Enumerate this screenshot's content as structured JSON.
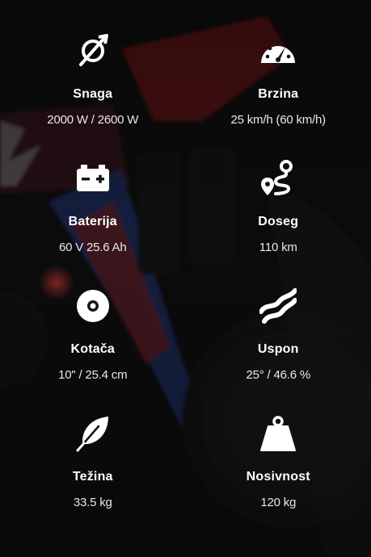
{
  "specs": [
    {
      "icon": "power-icon",
      "title": "Snaga",
      "value": "2000 W / 2600 W"
    },
    {
      "icon": "speedometer-icon",
      "title": "Brzina",
      "value": "25 km/h (60 km/h)"
    },
    {
      "icon": "battery-icon",
      "title": "Baterija",
      "value": "60 V 25.6 Ah"
    },
    {
      "icon": "route-icon",
      "title": "Doseg",
      "value": "110 km"
    },
    {
      "icon": "wheel-icon",
      "title": "Kotača",
      "value": "10\" / 25.4 cm"
    },
    {
      "icon": "slope-icon",
      "title": "Uspon",
      "value": "25° / 46.6 %"
    },
    {
      "icon": "feather-icon",
      "title": "Težina",
      "value": "33.5 kg"
    },
    {
      "icon": "weight-icon",
      "title": "Nosivnost",
      "value": "120 kg"
    }
  ]
}
